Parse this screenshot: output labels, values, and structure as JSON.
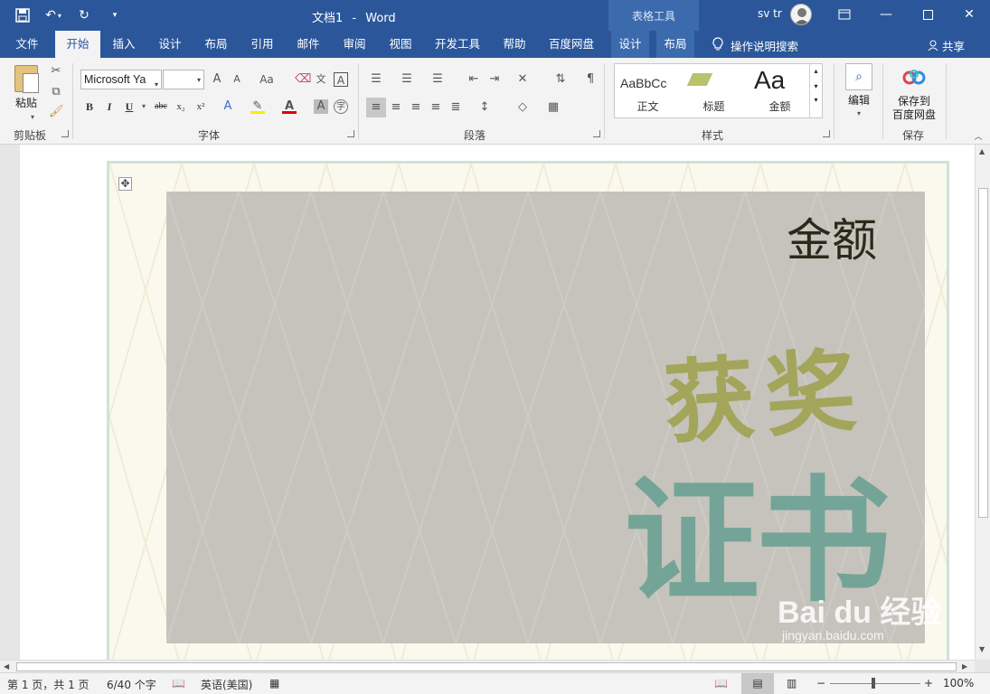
{
  "window": {
    "doc_title": "文档1",
    "title_sep": "-",
    "app_name": "Word",
    "context_group": "表格工具",
    "user_name": "sv tr",
    "controls": [
      "restore-ribbon",
      "minimize",
      "maximize",
      "close"
    ]
  },
  "tabs": {
    "file": "文件",
    "home": "开始",
    "insert": "插入",
    "design": "设计",
    "layout": "布局",
    "references": "引用",
    "mailings": "邮件",
    "review": "审阅",
    "view": "视图",
    "developer": "开发工具",
    "help": "帮助",
    "baidu": "百度网盘",
    "table_design": "设计",
    "table_layout": "布局",
    "tellme": "操作说明搜索",
    "share": "共享"
  },
  "ribbon": {
    "clipboard": {
      "paste": "粘贴",
      "label": "剪贴板"
    },
    "font": {
      "font_name": "Microsoft Ya",
      "font_size": "",
      "bold": "B",
      "italic": "I",
      "underline": "U",
      "strike": "abc",
      "subscript": "x₂",
      "superscript": "x²",
      "grow": "A",
      "shrink": "A",
      "case": "Aa",
      "label": "字体"
    },
    "paragraph": {
      "label": "段落"
    },
    "styles": {
      "items": [
        {
          "preview": "AaBbCc",
          "name": "正文"
        },
        {
          "preview": "",
          "name": "标题"
        },
        {
          "preview": "Aa",
          "name": "金额"
        }
      ],
      "label": "样式"
    },
    "editing": {
      "label": "编辑"
    },
    "save": {
      "button": "保存到\n百度网盘",
      "line1": "保存到",
      "line2": "百度网盘",
      "label": "保存"
    }
  },
  "document": {
    "amount": "金额",
    "award": "获奖",
    "certificate": "证书",
    "watermark": "Bai du 经验",
    "watermark_url": "jingyan.baidu.com"
  },
  "status": {
    "page": "第 1 页，共 1 页",
    "words": "6/40 个字",
    "language": "英语(美国)",
    "zoom": "100%"
  },
  "colors": {
    "title_bar": "#2b579a",
    "ribbon": "#f3f3f3",
    "card": "#c5c3bc",
    "award_text": "#a3a55a",
    "cert_text": "#74a497"
  }
}
